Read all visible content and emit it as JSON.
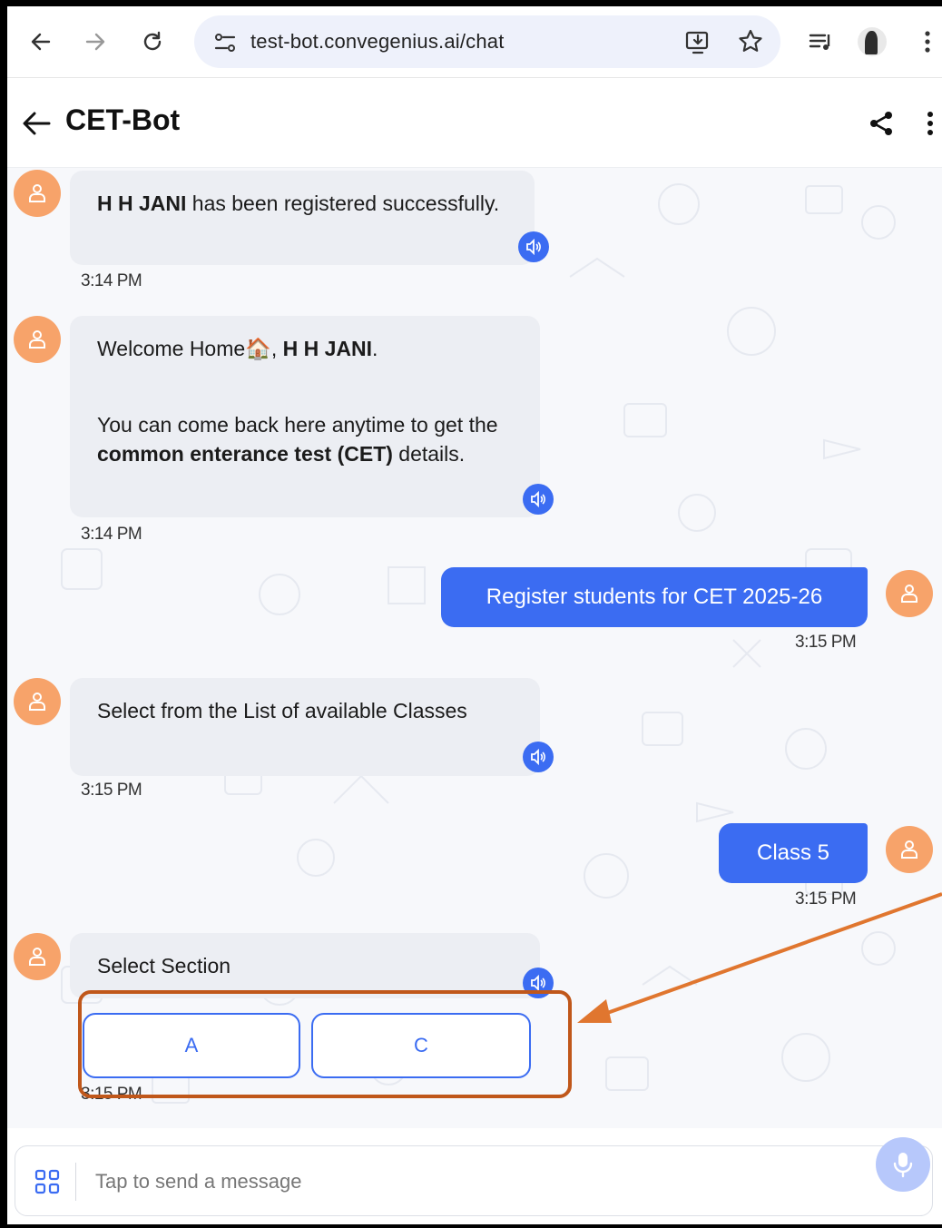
{
  "browser": {
    "url": "test-bot.convegenius.ai/chat"
  },
  "header": {
    "title": "CET-Bot"
  },
  "messages": {
    "m1": {
      "bold": "H H JANI",
      "text": " has been registered successfully.",
      "time": "3:14 PM"
    },
    "m2": {
      "line1_pre": "Welcome Home",
      "line1_emoji": "🏠",
      "line1_sep": ", ",
      "line1_bold": "H H JANI",
      "line1_end": ".",
      "p2_pre": "You can come back here anytime to get the ",
      "p2_bold1": "common enterance test (CET)",
      "p2_post": " details.",
      "time": "3:14 PM"
    },
    "m3": {
      "text": "Register students for CET 2025-26",
      "time": "3:15 PM"
    },
    "m4": {
      "text": "Select from the List of available Classes",
      "time": "3:15 PM"
    },
    "m5": {
      "text": "Class 5",
      "time": "3:15 PM"
    },
    "m6": {
      "text": "Select Section",
      "time": "3:15 PM"
    }
  },
  "section_options": [
    "A",
    "C"
  ],
  "input": {
    "placeholder": "Tap to send a message"
  },
  "colors": {
    "accent": "#3b6cf2",
    "avatar": "#f7a36a",
    "highlight": "#c0571a"
  }
}
